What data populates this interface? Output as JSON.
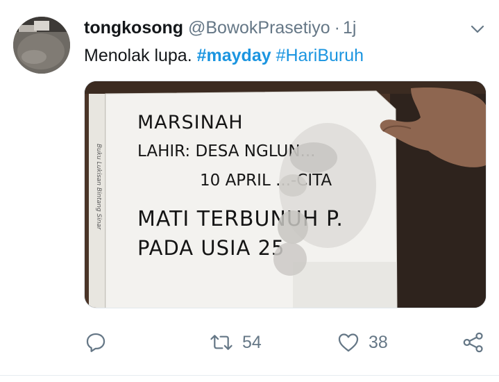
{
  "tweet": {
    "author": {
      "display_name": "tongkosong",
      "handle": "@BowokPrasetiyo",
      "separator": "·",
      "time": "1j",
      "avatar_icon": "avatar-photo"
    },
    "text": {
      "lead": "Menolak lupa.",
      "hashtags": [
        "#mayday",
        "#HariBuruh"
      ]
    },
    "media": {
      "type": "photo",
      "handwritten_lines": [
        "MARSINAH",
        "LAHIR: DESA NGLUN...",
        "10 APRIL ...-CITA",
        "MATI TERBUNUH P.",
        "PADA USIA 25"
      ],
      "spine_text": "Buku Lukisan Bintang Sinar"
    },
    "actions": {
      "reply": {
        "icon": "reply-icon",
        "count": ""
      },
      "retweet": {
        "icon": "retweet-icon",
        "count": "54"
      },
      "like": {
        "icon": "heart-icon",
        "count": "38"
      },
      "share": {
        "icon": "share-icon"
      }
    },
    "menu_icon": "chevron-down-icon",
    "colors": {
      "text": "#14171a",
      "secondary": "#657786",
      "link": "#1b95e0"
    }
  }
}
